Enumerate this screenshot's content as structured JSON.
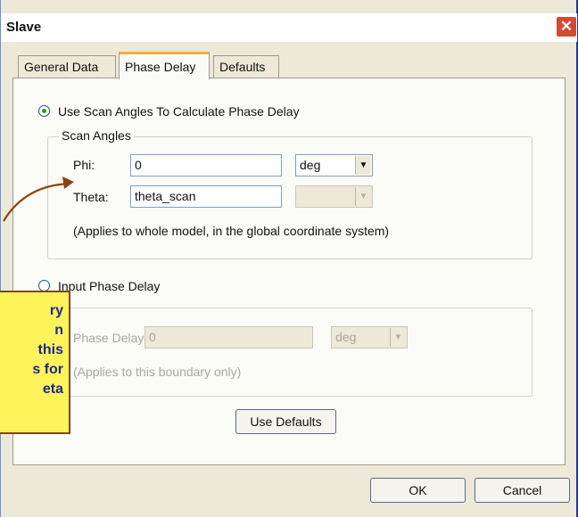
{
  "window": {
    "title": "Slave",
    "close_symbol": "✕"
  },
  "tabs": [
    {
      "label": "General Data",
      "active": false
    },
    {
      "label": "Phase Delay",
      "active": true
    },
    {
      "label": "Defaults",
      "active": false
    }
  ],
  "scan_option": {
    "label": "Use Scan Angles To Calculate Phase Delay",
    "selected": true
  },
  "scan_angles": {
    "title": "Scan Angles",
    "phi": {
      "label": "Phi:",
      "value": "0",
      "unit": "deg"
    },
    "theta": {
      "label": "Theta:",
      "value": "theta_scan",
      "unit": ""
    },
    "note": "(Applies to whole model, in the global coordinate system)"
  },
  "input_option": {
    "label": "Input Phase Delay",
    "selected": false
  },
  "phase_delay": {
    "label": "Phase Delay:",
    "value": "0",
    "unit": "deg",
    "note": "(Applies to this boundary only)"
  },
  "buttons": {
    "use_defaults": "Use Defaults",
    "ok": "OK",
    "cancel": "Cancel"
  },
  "callout": {
    "lines": [
      "ry",
      "n",
      "this",
      "s for",
      "eta"
    ],
    "background": "#fff35c",
    "text_color": "#1b2a88"
  },
  "colors": {
    "title_bar": "#ffffff",
    "close_button": "#d6492f",
    "active_tab_accent": "#f5ae3e",
    "arrow": "#8b4513"
  }
}
